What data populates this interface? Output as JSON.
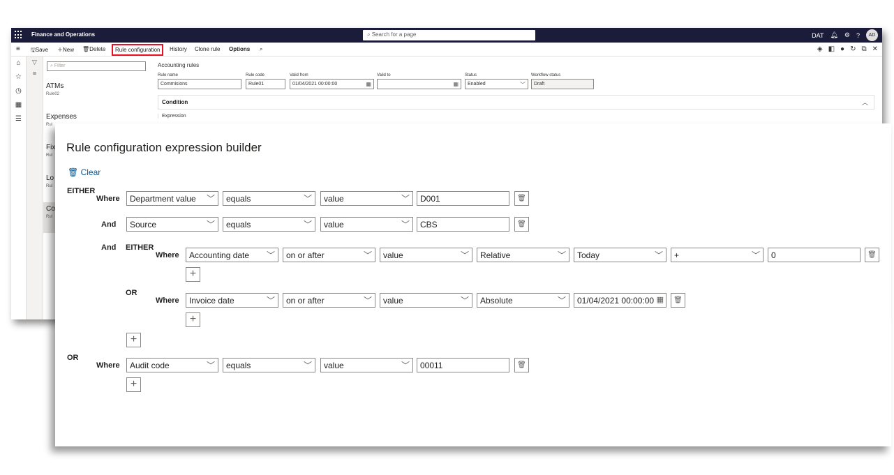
{
  "app": {
    "title": "Finance and Operations",
    "search_placeholder": "Search for a page",
    "company": "DAT",
    "avatar_initials": "AD",
    "icons": [
      "bell-icon",
      "gear-icon",
      "help-icon"
    ]
  },
  "toolbar": {
    "save": "Save",
    "new": "New",
    "delete": "Delete",
    "rule_configuration": "Rule configuration",
    "history": "History",
    "clone_rule": "Clone rule",
    "options": "Options"
  },
  "list": {
    "filter_placeholder": "Filter",
    "items": [
      {
        "name": "ATMs",
        "code": "Rule02"
      },
      {
        "name": "Expenses",
        "code": "Rul"
      },
      {
        "name": "Fix",
        "code": "Rul"
      },
      {
        "name": "Lo",
        "code": "Rul"
      },
      {
        "name": "Co",
        "code": "Rul"
      }
    ]
  },
  "detail": {
    "section_title": "Accounting rules",
    "rule_name_label": "Rule name",
    "rule_name": "Commisions",
    "rule_code_label": "Rule code",
    "rule_code": "Rule01",
    "valid_from_label": "Valid from",
    "valid_from": "01/04/2021 00:00:00",
    "valid_to_label": "Valid to",
    "valid_to": "",
    "status_label": "Status",
    "status": "Enabled",
    "workflow_status_label": "Workflow status",
    "workflow_status": "Draft",
    "condition_label": "Condition",
    "expression_label": "Expression"
  },
  "dialog": {
    "title": "Rule configuration expression builder",
    "clear": "Clear",
    "kw_either": "EITHER",
    "kw_where": "Where",
    "kw_and": "And",
    "kw_or": "OR",
    "row1": {
      "field": "Department value",
      "operator": "equals",
      "type": "value",
      "value": "D001"
    },
    "row2": {
      "field": "Source",
      "operator": "equals",
      "type": "value",
      "value": "CBS"
    },
    "row3": {
      "field": "Accounting date",
      "operator": "on or after",
      "type": "value",
      "mode": "Relative",
      "anchor": "Today",
      "sign": "+",
      "offset": "0"
    },
    "row4": {
      "field": "Invoice date",
      "operator": "on or after",
      "type": "value",
      "mode": "Absolute",
      "date": "01/04/2021 00:00:00"
    },
    "row5": {
      "field": "Audit code",
      "operator": "equals",
      "type": "value",
      "value": "00011"
    },
    "add_symbol": "+",
    "dropdown_symbol": "﹀"
  }
}
